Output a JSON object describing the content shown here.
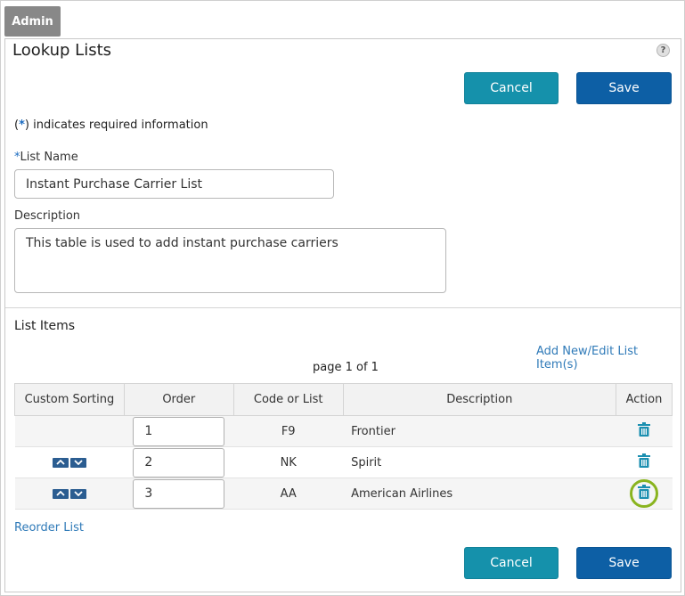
{
  "header": {
    "tab": "Admin"
  },
  "panel": {
    "title": "Lookup Lists",
    "help_icon": "help-icon",
    "cancel_label": "Cancel",
    "save_label": "Save"
  },
  "form": {
    "required_star": "*",
    "required_note": " indicates required information",
    "list_name_star": "*",
    "list_name_label": "List Name",
    "list_name_value": "Instant Purchase Carrier List",
    "description_label": "Description",
    "description_value": "This table is used to add instant purchase carriers"
  },
  "list_items": {
    "title": "List Items",
    "add_edit_link": "Add New/Edit List Item(s)",
    "page_info": "page 1 of 1",
    "columns": [
      "Custom Sorting",
      "Order",
      "Code or List",
      "Description",
      "Action"
    ],
    "rows": [
      {
        "order": "1",
        "code": "F9",
        "description": "Frontier",
        "has_sort": false
      },
      {
        "order": "2",
        "code": "NK",
        "description": "Spirit",
        "has_sort": true
      },
      {
        "order": "3",
        "code": "AA",
        "description": "American Airlines",
        "has_sort": true
      }
    ],
    "reorder_link": "Reorder List"
  },
  "colors": {
    "cancel": "#1591ab",
    "save": "#0d5fa5",
    "link": "#2f7ab8",
    "highlight_ring": "#8ab41f",
    "trash_icon": "#1b8fb0"
  }
}
